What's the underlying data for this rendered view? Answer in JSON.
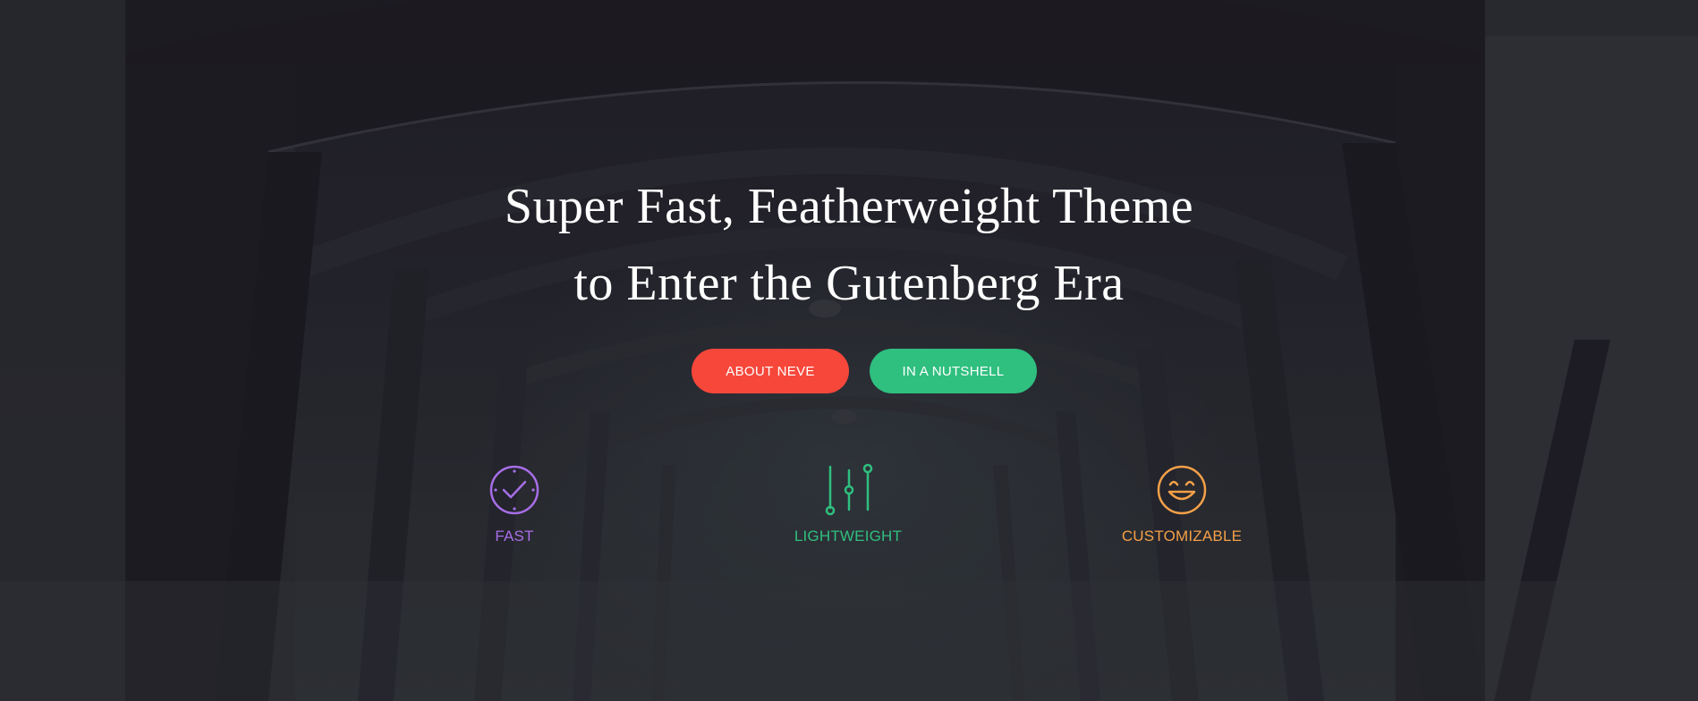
{
  "hero": {
    "title_line1": "Super Fast, Featherweight Theme",
    "title_line2": "to Enter the Gutenberg Era",
    "buttons": {
      "about": "ABOUT NEVE",
      "nutshell": "IN A NUTSHELL"
    },
    "features": [
      {
        "label": "FAST",
        "icon": "clock-check-icon",
        "color": "#a86ee8"
      },
      {
        "label": "LIGHTWEIGHT",
        "icon": "sliders-icon",
        "color": "#2fbf7f"
      },
      {
        "label": "CUSTOMIZABLE",
        "icon": "smiley-icon",
        "color": "#f5a048"
      }
    ]
  },
  "colors": {
    "background": "#23222b",
    "about_button": "#f7473a",
    "nutshell_button": "#2fbf7f"
  }
}
